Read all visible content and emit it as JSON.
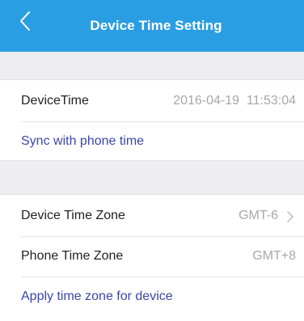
{
  "header": {
    "title": "Device Time Setting",
    "back_icon": "chevron-left-icon"
  },
  "time_section": {
    "device_time_label": "DeviceTime",
    "device_time_value": "2016-04-19  11:53:04",
    "sync_label": "Sync with phone time"
  },
  "zone_section": {
    "device_zone_label": "Device Time Zone",
    "device_zone_value": "GMT-6",
    "phone_zone_label": "Phone Time Zone",
    "phone_zone_value": "GMT+8",
    "apply_label": "Apply time zone for device"
  },
  "colors": {
    "header_bg": "#2a9ee3",
    "link": "#3a46a8",
    "value_gray": "#a8a8ac",
    "background": "#eeeef0"
  }
}
